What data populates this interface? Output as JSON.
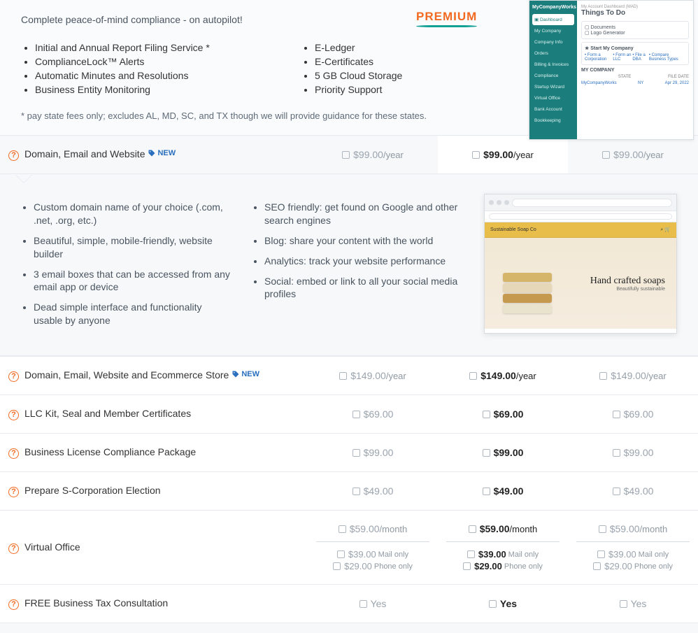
{
  "intro": "Complete peace-of-mind compliance - on autopilot!",
  "premium_label": "PREMIUM",
  "compliance_features_left": [
    "Initial and Annual Report Filing Service *",
    "ComplianceLock™ Alerts",
    "Automatic Minutes and Resolutions",
    "Business Entity Monitoring"
  ],
  "compliance_features_right": [
    "E-Ledger",
    "E-Certificates",
    "5 GB Cloud Storage",
    "Priority Support"
  ],
  "footnote": "* pay state fees only; excludes AL, MD, SC, and TX though we will provide guidance for these states.",
  "dashboard_mock": {
    "brand": "MyCompanyWorks",
    "breadcrumb": "My Account Dashboard (MAD)",
    "header": "Things To Do",
    "todo": [
      "Documents",
      "Logo Generator"
    ],
    "start_label": "Start My Company",
    "links": [
      "Form a Corporation",
      "Form an LLC",
      "File a DBA",
      "Compare Business Types"
    ],
    "company_section": "MY COMPANY",
    "tbl_headers": [
      "",
      "STATE",
      "FILE DATE"
    ],
    "company_row": [
      "MyCompanyWorks",
      "NY",
      "Apr 29, 2022"
    ],
    "side_items": [
      "Dashboard",
      "My Company",
      "Company Info",
      "Orders",
      "Billing & Invoices",
      "Compliance",
      "Startup Wizard",
      "Virtual Office",
      "Bank Account",
      "Bookkeeping"
    ]
  },
  "new_badge": "NEW",
  "rows": [
    {
      "name": "Domain, Email and Website",
      "new": true,
      "prices": [
        "$99.00",
        "$99.00",
        "$99.00"
      ],
      "unit": "/year",
      "active_col": 1
    },
    {
      "name": "Domain, Email, Website and Ecommerce Store",
      "new": true,
      "prices": [
        "$149.00",
        "$149.00",
        "$149.00"
      ],
      "unit": "/year",
      "active_col": 1
    },
    {
      "name": "LLC Kit, Seal and Member Certificates",
      "new": false,
      "prices": [
        "$69.00",
        "$69.00",
        "$69.00"
      ],
      "unit": "",
      "active_col": 1
    },
    {
      "name": "Business License Compliance Package",
      "new": false,
      "prices": [
        "$99.00",
        "$99.00",
        "$99.00"
      ],
      "unit": "",
      "active_col": 1
    },
    {
      "name": "Prepare S-Corporation Election",
      "new": false,
      "prices": [
        "$49.00",
        "$49.00",
        "$49.00"
      ],
      "unit": "",
      "active_col": 1
    },
    {
      "name": "Virtual Office",
      "new": false,
      "prices": [
        "$59.00",
        "$59.00",
        "$59.00"
      ],
      "unit": "/month",
      "active_col": 1,
      "sub_options": [
        {
          "price": "$39.00",
          "suffix": "Mail only"
        },
        {
          "price": "$29.00",
          "suffix": "Phone only"
        }
      ]
    },
    {
      "name": "FREE Business Tax Consultation",
      "new": false,
      "prices": [
        "Yes",
        "Yes",
        "Yes"
      ],
      "unit": "",
      "active_col": 1
    }
  ],
  "domain_features_left": [
    "Custom domain name of your choice (.com, .net, .org, etc.)",
    "Beautiful, simple, mobile-friendly, website builder",
    "3 email boxes that can be accessed from any email app or device",
    "Dead simple interface and functionality usable by anyone"
  ],
  "domain_features_right": [
    "SEO friendly: get found on Google and other search engines",
    "Blog: share your content with the world",
    "Analytics: track your website performance",
    "Social: embed or link to all your social media profiles"
  ],
  "website_mock": {
    "brand": "Sustainable Soap Co",
    "hero_title": "Hand crafted soaps",
    "hero_sub": "Beautifully sustainable"
  }
}
